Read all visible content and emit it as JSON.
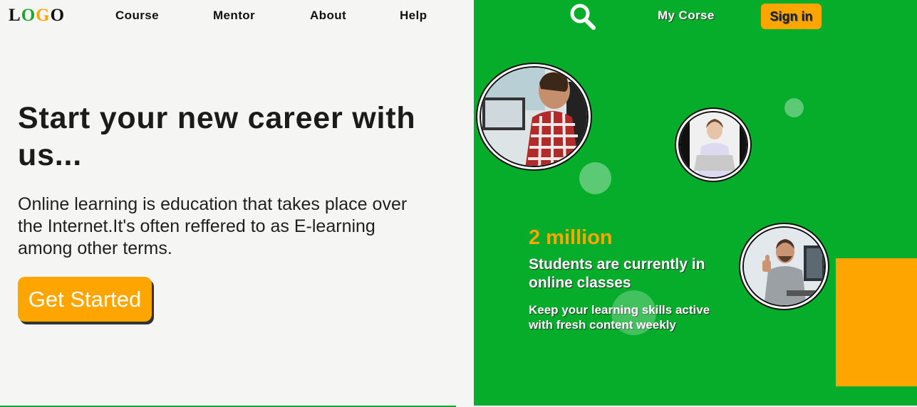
{
  "header": {
    "logo": [
      "L",
      "O",
      "G",
      "O"
    ],
    "logo_colors": [
      "#111111",
      "#1fa52c",
      "#ffa500",
      "#111111"
    ],
    "nav": [
      {
        "label": "Course"
      },
      {
        "label": "Mentor"
      },
      {
        "label": "About"
      },
      {
        "label": "Help"
      }
    ],
    "search_icon": "search-icon",
    "my_course_label": "My Corse",
    "signin_label": "Sign in"
  },
  "hero": {
    "title": "Start your new career with us...",
    "description": "Online learning is education that takes place over the Internet.It's often reffered to as E-learning among other terms.",
    "cta_label": "Get Started"
  },
  "stats": {
    "number": "2 million",
    "title": "Students are currently in online classes",
    "subtitle": "Keep your learning skills active with fresh content weekly"
  },
  "colors": {
    "accent_green": "#05ad2a",
    "accent_orange": "#ffa500",
    "background": "#f5f6f4"
  }
}
